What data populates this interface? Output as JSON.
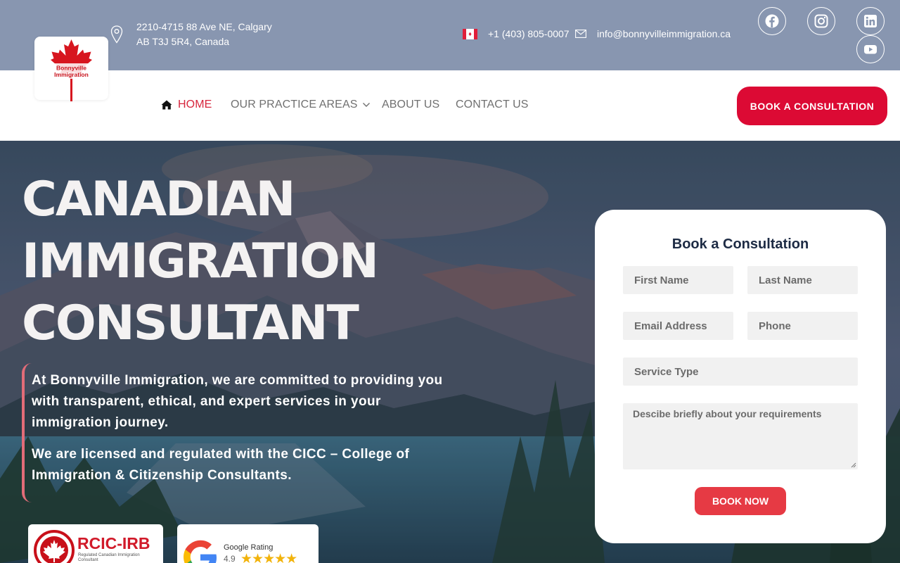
{
  "brand": {
    "logo_name": "Bonnyville",
    "logo_sub": "Immigration"
  },
  "topbar": {
    "address_line1": "2210-4715 88 Ave NE, Calgary",
    "address_line2": "AB T3J 5R4, Canada",
    "phone": "+1 (403) 805-0007",
    "email": "info@bonnyvilleimmigration.ca",
    "social": [
      "facebook-icon",
      "instagram-icon",
      "linkedin-icon",
      "youtube-icon"
    ]
  },
  "nav": {
    "home": "HOME",
    "practice_areas": "OUR PRACTICE AREAS",
    "about": "ABOUT US",
    "contact": "CONTACT US",
    "cta": "BOOK A CONSULTATION"
  },
  "hero": {
    "title_line1": "CANADIAN",
    "title_line2": "IMMIGRATION",
    "title_line3": "CONSULTANT",
    "para1": "At Bonnyville Immigration, we are committed to providing you with transparent, ethical, and expert services in your immigration journey.",
    "para2": "We are licensed and regulated with the CICC – College of Immigration & Citizenship Consultants."
  },
  "badges": {
    "rcic_title": "RCIC-IRB",
    "rcic_sub": "Regulated Canadian Immigration Consultant",
    "google_label": "Google Rating",
    "google_score": "4.9",
    "google_stars": 4.9
  },
  "form": {
    "title": "Book a Consultation",
    "first_name": "First Name",
    "last_name": "Last Name",
    "email": "Email Address",
    "phone": "Phone",
    "service": "Service Type",
    "message": "Descibe briefly about your requirements",
    "submit": "BOOK NOW"
  },
  "colors": {
    "topbar": "#8896b0",
    "accent": "#dc0a34",
    "nav_active": "#d7263d"
  }
}
